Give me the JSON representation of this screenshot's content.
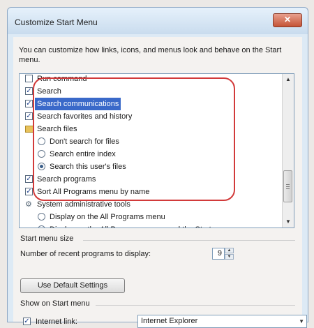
{
  "window": {
    "title": "Customize Start Menu",
    "close_glyph": "✕"
  },
  "description": "You can customize how links, icons, and menus look and behave on the Start menu.",
  "list": {
    "items": [
      {
        "type": "checkbox",
        "label": "Run command",
        "checked": false,
        "indent": 0
      },
      {
        "type": "checkbox",
        "label": "Search",
        "checked": true,
        "indent": 0
      },
      {
        "type": "checkbox",
        "label": "Search communications",
        "checked": true,
        "indent": 0,
        "selected": true
      },
      {
        "type": "checkbox",
        "label": "Search favorites and history",
        "checked": true,
        "indent": 0
      },
      {
        "type": "folder",
        "label": "Search files",
        "icon": "folder-icon",
        "indent": 0
      },
      {
        "type": "radio",
        "label": "Don't search for files",
        "checked": false,
        "indent": 1
      },
      {
        "type": "radio",
        "label": "Search entire index",
        "checked": false,
        "indent": 1
      },
      {
        "type": "radio",
        "label": "Search this user's files",
        "checked": true,
        "indent": 1
      },
      {
        "type": "checkbox",
        "label": "Search programs",
        "checked": true,
        "indent": 0
      },
      {
        "type": "checkbox",
        "label": "Sort All Programs menu by name",
        "checked": true,
        "indent": 0
      },
      {
        "type": "folder",
        "label": "System administrative tools",
        "icon": "admin-tools-icon",
        "indent": 0
      },
      {
        "type": "radio",
        "label": "Display on the All Programs menu",
        "checked": false,
        "indent": 1
      },
      {
        "type": "radio",
        "label": "Display on the All Programs menu and the Start menu",
        "checked": false,
        "indent": 1
      }
    ],
    "check_glyph": "✓",
    "scroll_up": "▲",
    "scroll_down": "▼",
    "accent": "#d23a3a"
  },
  "start_menu_size": {
    "heading": "Start menu size",
    "recent_label": "Number of recent programs to display:",
    "recent_value": "9",
    "spin_up": "▲",
    "spin_down": "▼"
  },
  "default_button": "Use Default Settings",
  "show_on_start": {
    "heading": "Show on Start menu",
    "internet_label": "Internet link:",
    "internet_checked": true,
    "browser": "Internet Explorer",
    "arrow": "▼"
  },
  "colors": {
    "selection": "#3a69c9",
    "callout": "#d23a3a",
    "titlebar": "#c9dcee"
  }
}
